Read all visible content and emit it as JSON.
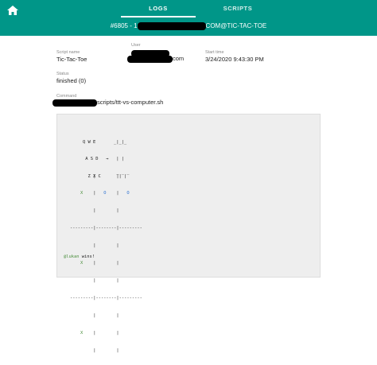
{
  "header": {
    "tabs": [
      {
        "label": "LOGS",
        "active": true
      },
      {
        "label": "SCRIPTS",
        "active": false
      }
    ],
    "subtitle_prefix": "#6805 - 1",
    "subtitle_suffix": "COM@TIC-TAC-TOE",
    "accent_color": "#009688",
    "home_icon": "home-icon"
  },
  "info": {
    "user_label": "User",
    "user_value_suffix": "com",
    "script_name_label": "Script name",
    "script_name": "Tic-Tac-Toe",
    "start_time_label": "Start time",
    "start_time": "3/24/2020 9:43:30 PM",
    "status_label": "Status",
    "status": "finished (0)",
    "command_label": "Command",
    "command_suffix": "scripts/ttt-vs-computer.sh"
  },
  "terminal": {
    "legend": {
      "row1_keys": "Q W E",
      "row2_keys": "A S D",
      "row3_keys": "Z X C",
      "arrow": "→",
      "mini_row1": "_|_|_",
      "mini_row2": " | | ",
      "mini_row3": "‾|‾|‾"
    },
    "board": {
      "cells": [
        [
          "X",
          "O",
          "O"
        ],
        [
          "X",
          "",
          ""
        ],
        [
          "X",
          "",
          ""
        ]
      ],
      "divider": "---------|--------|---------"
    },
    "winner_name": "@lukan",
    "winner_text": " wins!"
  }
}
